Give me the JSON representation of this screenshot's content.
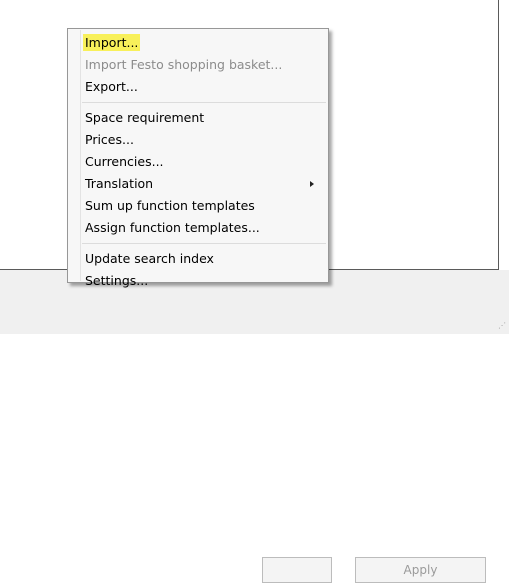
{
  "menu": {
    "groups": [
      [
        {
          "label": "Import...",
          "enabled": true,
          "highlighted": true
        },
        {
          "label": "Import Festo shopping basket...",
          "enabled": false
        },
        {
          "label": "Export...",
          "enabled": true
        }
      ],
      [
        {
          "label": "Space requirement",
          "enabled": true
        },
        {
          "label": "Prices...",
          "enabled": true
        },
        {
          "label": "Currencies...",
          "enabled": true
        },
        {
          "label": "Translation",
          "enabled": true,
          "submenu": true
        },
        {
          "label": "Sum up function templates",
          "enabled": true
        },
        {
          "label": "Assign function templates...",
          "enabled": true
        }
      ],
      [
        {
          "label": "Update search index",
          "enabled": true
        },
        {
          "label": "Settings...",
          "enabled": true
        }
      ]
    ]
  },
  "buttons": {
    "apply_label": "Apply"
  },
  "colors": {
    "highlight": "#f8f05a",
    "disabled_text": "#8c8c8c",
    "menu_background": "#f7f7f7",
    "dialog_background": "#f0f0f0"
  }
}
